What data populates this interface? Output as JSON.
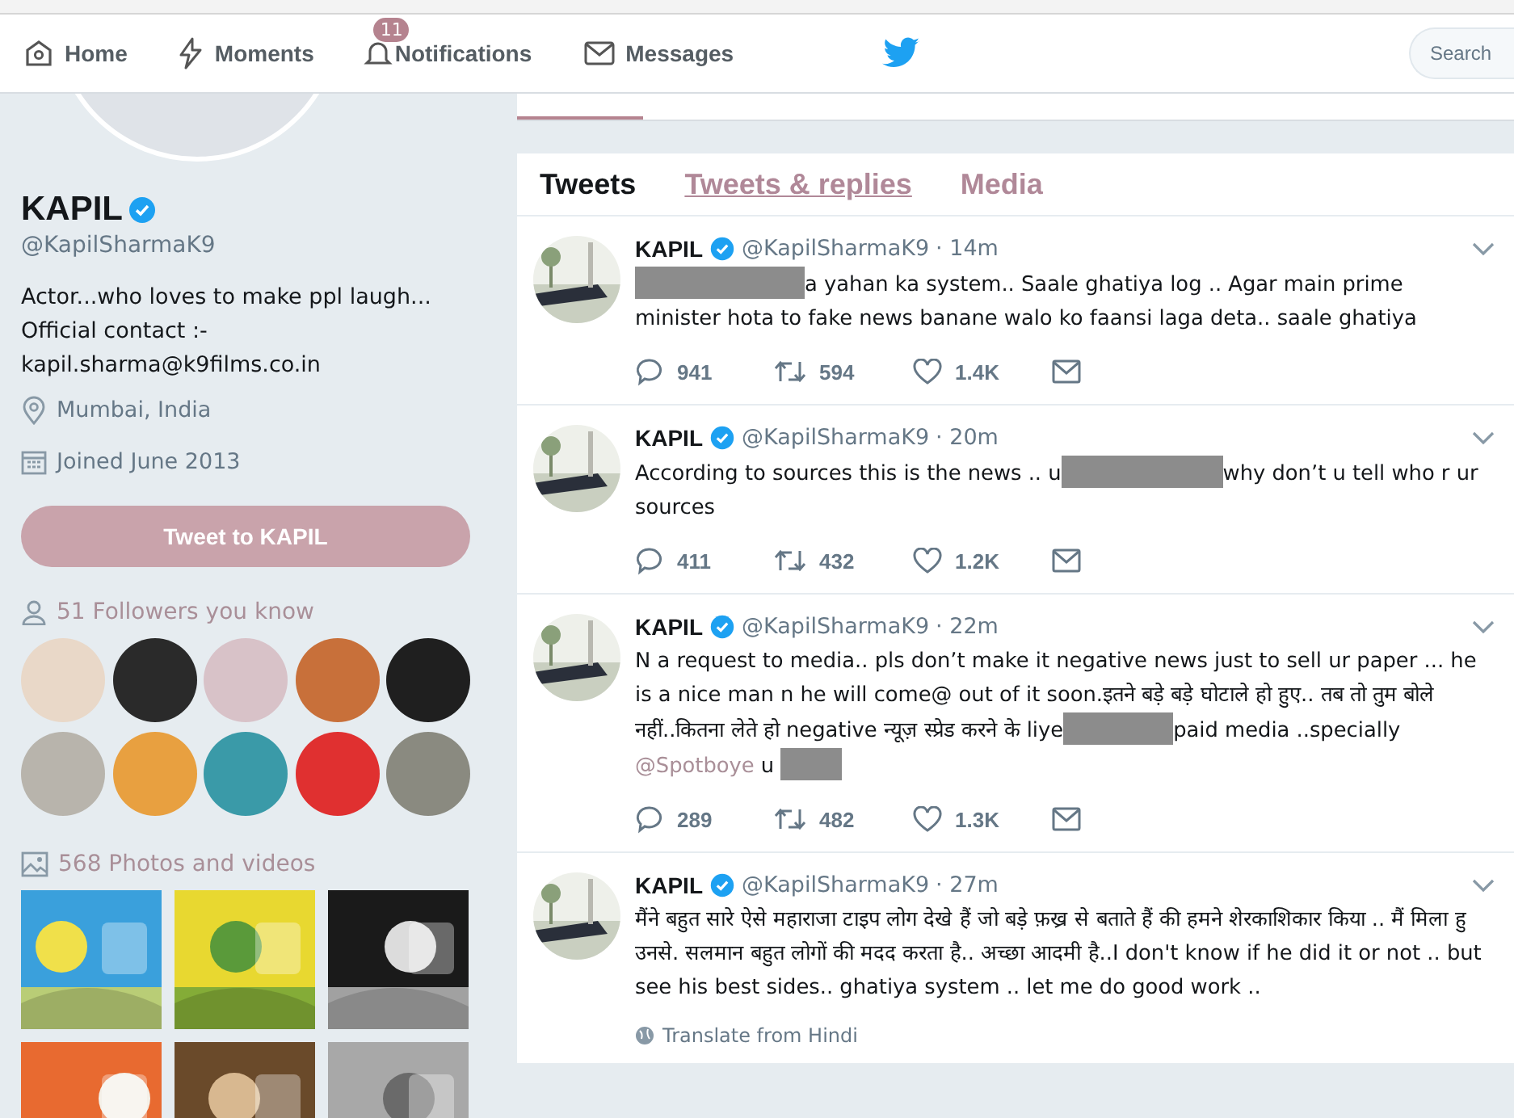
{
  "nav": {
    "items": [
      {
        "label": "Home"
      },
      {
        "label": "Moments"
      },
      {
        "label": "Notifications",
        "badge": "11"
      },
      {
        "label": "Messages"
      }
    ],
    "search": {
      "placeholder": "Search"
    }
  },
  "profile": {
    "name": "KAPIL",
    "verified": true,
    "handle": "@KapilSharmaK9",
    "bio": [
      "Actor...who loves to make ppl laugh...",
      "Official contact :-",
      "kapil.sharma@k9films.co.in"
    ],
    "location": "Mumbai, India",
    "joined": "Joined June 2013",
    "tweet_button": "Tweet to KAPIL",
    "followers_label": "51 Followers you know",
    "photos_label": "568 Photos and videos"
  },
  "tabs": [
    {
      "label": "Tweets",
      "selected": true
    },
    {
      "label": "Tweets & replies",
      "selected": false
    },
    {
      "label": "Media",
      "selected": false
    }
  ],
  "tweets": [
    {
      "name": "KAPIL",
      "verified": true,
      "handle": "@KapilSharmaK9",
      "time": "· 14m",
      "text": [
        {
          "kind": "redacted"
        },
        {
          "kind": "text",
          "text": "a yahan ka system.. Saale ghatiya log .. Agar main prime minister hota to fake news banane walo ko faansi laga deta.. saale ghatiya"
        }
      ],
      "stats": {
        "replies": "941",
        "retweets": "594",
        "likes": "1.4K"
      }
    },
    {
      "name": "KAPIL",
      "verified": true,
      "handle": "@KapilSharmaK9",
      "time": "· 20m",
      "text": [
        {
          "kind": "text",
          "text": "According to sources this is the news .. u"
        },
        {
          "kind": "redacted"
        },
        {
          "kind": "text",
          "text": "why don’t u tell who r ur sources"
        }
      ],
      "stats": {
        "replies": "411",
        "retweets": "432",
        "likes": "1.2K"
      }
    },
    {
      "name": "KAPIL",
      "verified": true,
      "handle": "@KapilSharmaK9",
      "time": "· 22m",
      "text": [
        {
          "kind": "text",
          "text": "N a request to media.. pls don’t make it negative news just to sell ur paper ... he is a nice man n he will come@ out of it soon.इतने बड़े बड़े घोटाले हो हुए.. तब तो तुम बोले नहीं..कितना लेते हो negative न्यूज़ स्प्रेड करने के liye"
        },
        {
          "kind": "redacted"
        },
        {
          "kind": "text",
          "text": "paid media ..specially "
        },
        {
          "kind": "mention",
          "text": "@Spotboye"
        },
        {
          "kind": "text",
          "text": " u "
        },
        {
          "kind": "redacted"
        }
      ],
      "stats": {
        "replies": "289",
        "retweets": "482",
        "likes": "1.3K"
      }
    },
    {
      "name": "KAPIL",
      "verified": true,
      "handle": "@KapilSharmaK9",
      "time": "· 27m",
      "text": [
        {
          "kind": "text",
          "text": "मैंने बहुत सारे ऐसे महाराजा टाइप लोग देखे हैं जो बड़े फ़ख्र से बताते हैं की हमने शेरकाशिकार किया .. मैं मिला हु  उनसे. सलमान बहुत लोगों की मदद करता है.. अच्छा आदमी है..I don't know if he did it or not .. but see his best sides.. ghatiya system .. let me do good work .."
        }
      ],
      "translate": "Translate from Hindi"
    }
  ]
}
